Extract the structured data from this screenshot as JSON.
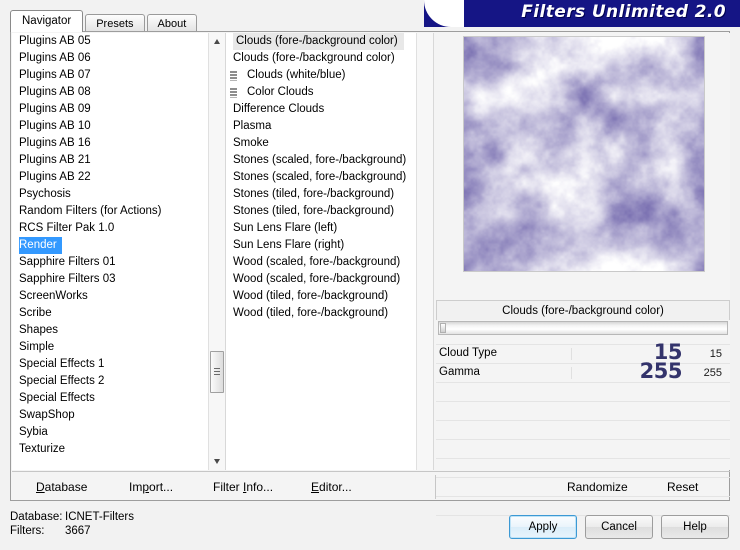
{
  "window": {
    "banner_title": "Filters Unlimited 2.0"
  },
  "tabs": [
    {
      "label": "Navigator",
      "active": true
    },
    {
      "label": "Presets",
      "active": false
    },
    {
      "label": "About",
      "active": false
    }
  ],
  "categories": {
    "selected": "Render",
    "items": [
      {
        "label": "Plugins AB 05"
      },
      {
        "label": "Plugins AB 06"
      },
      {
        "label": "Plugins AB 07"
      },
      {
        "label": "Plugins AB 08"
      },
      {
        "label": "Plugins AB 09"
      },
      {
        "label": "Plugins AB 10"
      },
      {
        "label": "Plugins AB 16"
      },
      {
        "label": "Plugins AB 21"
      },
      {
        "label": "Plugins AB 22"
      },
      {
        "label": "Psychosis"
      },
      {
        "label": "Random Filters (for Actions)"
      },
      {
        "label": "RCS Filter Pak 1.0"
      },
      {
        "label": "Render",
        "selected": true
      },
      {
        "label": "Sapphire Filters 01"
      },
      {
        "label": "Sapphire Filters 03"
      },
      {
        "label": "ScreenWorks"
      },
      {
        "label": "Scribe"
      },
      {
        "label": "Shapes"
      },
      {
        "label": "Simple"
      },
      {
        "label": "Special Effects 1"
      },
      {
        "label": "Special Effects 2"
      },
      {
        "label": "Special Effects"
      },
      {
        "label": "SwapShop"
      },
      {
        "label": "Sybia"
      },
      {
        "label": "Texturize"
      }
    ]
  },
  "filters": {
    "selected": "Clouds (fore-/background color)",
    "items": [
      {
        "label": "Clouds (fore-/background color)",
        "selected": true,
        "icon": false
      },
      {
        "label": "Clouds (fore-/background color)",
        "icon": false
      },
      {
        "label": "Clouds (white/blue)",
        "icon": true
      },
      {
        "label": "Color Clouds",
        "icon": true
      },
      {
        "label": "Difference Clouds",
        "icon": false
      },
      {
        "label": "Plasma",
        "icon": false
      },
      {
        "label": "Smoke",
        "icon": false
      },
      {
        "label": "Stones (scaled, fore-/background)",
        "icon": false
      },
      {
        "label": "Stones (scaled, fore-/background)",
        "icon": false
      },
      {
        "label": "Stones (tiled, fore-/background)",
        "icon": false
      },
      {
        "label": "Stones (tiled, fore-/background)",
        "icon": false
      },
      {
        "label": "Sun Lens Flare (left)",
        "icon": false
      },
      {
        "label": "Sun Lens Flare (right)",
        "icon": false
      },
      {
        "label": "Wood (scaled, fore-/background)",
        "icon": false
      },
      {
        "label": "Wood (scaled, fore-/background)",
        "icon": false
      },
      {
        "label": "Wood (tiled, fore-/background)",
        "icon": false
      },
      {
        "label": "Wood (tiled, fore-/background)",
        "icon": false
      }
    ]
  },
  "parameters": {
    "title": "Clouds (fore-/background color)",
    "rows": [
      {
        "name": "Cloud Type",
        "big_value": "15",
        "value": "15"
      },
      {
        "name": "Gamma",
        "big_value": "255",
        "value": "255"
      }
    ],
    "empty_rows": 7
  },
  "action_bar": {
    "database": "Database",
    "import": "Import...",
    "filter_info": "Filter Info...",
    "editor": "Editor...",
    "randomize": "Randomize",
    "reset": "Reset"
  },
  "status": {
    "database_label": "Database:",
    "database_value": "ICNET-Filters",
    "filters_label": "Filters:",
    "filters_value": "3667"
  },
  "footer_buttons": {
    "apply": "Apply",
    "cancel": "Cancel",
    "help": "Help"
  },
  "colors": {
    "banner": "#151585",
    "selection_blue": "#3399ff",
    "param_number": "#33336b",
    "preview_cloud": "#6a5fa8"
  }
}
